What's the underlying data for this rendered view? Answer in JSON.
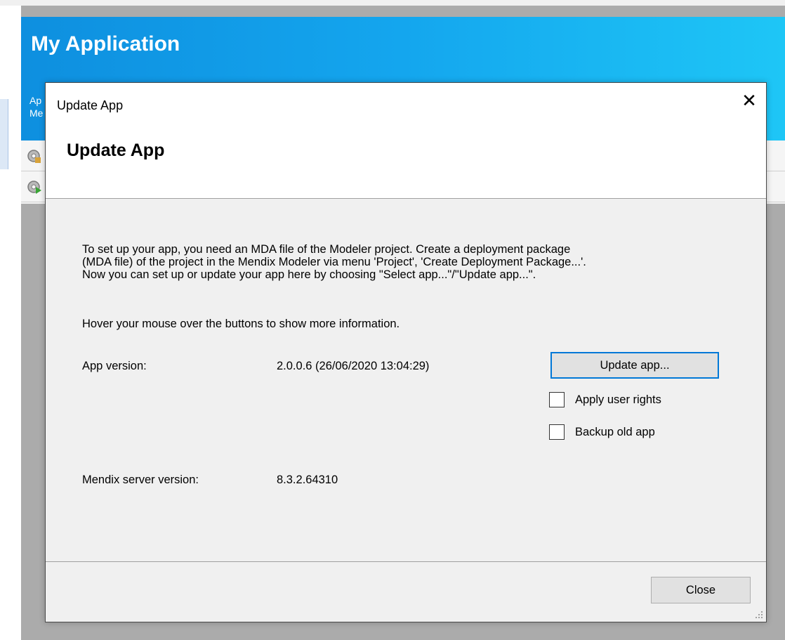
{
  "app": {
    "title": "My Application",
    "sub_line1": "Ap",
    "sub_line2": "Me"
  },
  "dialog": {
    "caption": "Update App",
    "heading": "Update App",
    "close_glyph": "✕",
    "intro_lines": [
      "To set up your app, you need an MDA file of the Modeler project. Create a deployment package",
      "(MDA file) of the project in the Mendix Modeler via menu 'Project', 'Create Deployment Package...'.",
      "Now you can set up or update your app here by choosing \"Select app...\"/\"Update app...\"."
    ],
    "hover_hint": "Hover your mouse over the buttons to show more information.",
    "app_version_label": "App version:",
    "app_version_value": "2.0.0.6 (26/06/2020 13:04:29)",
    "update_button": "Update app...",
    "apply_user_rights": {
      "label": "Apply user rights",
      "checked": false
    },
    "backup_old_app": {
      "label": "Backup old app",
      "checked": false
    },
    "server_version_label": "Mendix server version:",
    "server_version_value": "8.3.2.64310",
    "close_button": "Close"
  },
  "colors": {
    "header_gradient_start": "#0e8fdf",
    "header_gradient_end": "#1ec6f6",
    "focus_border": "#0078d7",
    "dialog_bg": "#f0f0f0"
  },
  "icons": [
    "gear-icon",
    "gear-run-icon",
    "close-icon",
    "resize-grip-icon"
  ]
}
